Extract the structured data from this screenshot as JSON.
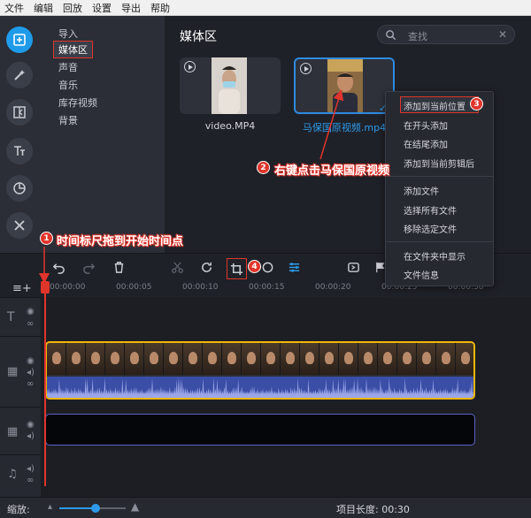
{
  "menubar": [
    "文件",
    "编辑",
    "回放",
    "设置",
    "导出",
    "帮助"
  ],
  "rail": {
    "icons": [
      "import-icon",
      "magic-wand-icon",
      "transition-icon",
      "titles-icon",
      "stickers-icon",
      "tools-icon"
    ]
  },
  "categories": [
    "导入",
    "媒体区",
    "声音",
    "音乐",
    "库存视频",
    "背景"
  ],
  "selected_category": "媒体区",
  "media": {
    "title": "媒体区",
    "search_placeholder": "查找",
    "items": [
      {
        "caption": "video.MP4",
        "selected": false
      },
      {
        "caption": "马保国原视频.mp4",
        "selected": true
      }
    ]
  },
  "context_menu": {
    "items": [
      "添加到当前位置",
      "在开头添加",
      "在结尾添加",
      "添加到当前剪辑后",
      "添加文件",
      "选择所有文件",
      "移除选定文件",
      "在文件夹中显示",
      "文件信息"
    ]
  },
  "ruler": {
    "ticks": [
      "00:00:00",
      "00:00:05",
      "00:00:10",
      "00:00:15",
      "00:00:20",
      "00:00:25",
      "00:00:30"
    ]
  },
  "bottom": {
    "zoom_label": "缩放:",
    "zoom_fraction": 0.55,
    "project_length_label": "项目长度:",
    "project_length": "00:30"
  },
  "annotations": {
    "step1": {
      "num": "1",
      "text": "时间标尺拖到开始时间点"
    },
    "step2": {
      "num": "2",
      "text": "右键点击马保国原视频"
    },
    "step3": {
      "num": "3"
    },
    "step4": {
      "num": "4"
    }
  },
  "colors": {
    "accent": "#2d9bea",
    "annotation_red": "#e0352b",
    "clip_border": "#f2b705",
    "audio_wave": "#3b4ea6"
  }
}
